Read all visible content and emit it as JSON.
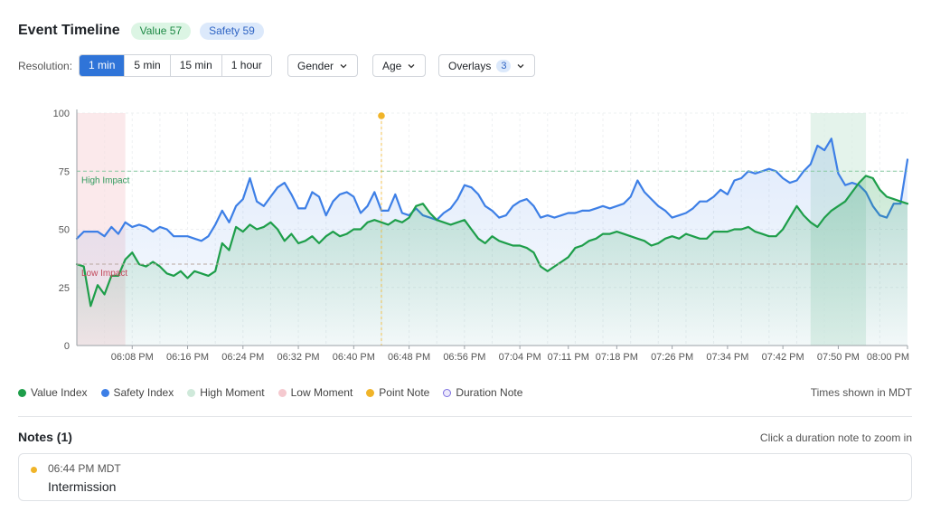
{
  "header": {
    "title": "Event Timeline",
    "value_badge": "Value 57",
    "safety_badge": "Safety 59"
  },
  "controls": {
    "resolution_label": "Resolution:",
    "resolutions": [
      "1 min",
      "5 min",
      "15 min",
      "1 hour"
    ],
    "active_resolution": "1 min",
    "gender_label": "Gender",
    "age_label": "Age",
    "overlays_label": "Overlays",
    "overlays_count": "3"
  },
  "colors": {
    "value": "#1e9e4a",
    "safety": "#3d7fe6",
    "high_moment": "#cfe9da",
    "low_moment": "#f5c9cf",
    "point_note": "#f0b429",
    "duration_note": "#7d6fe0"
  },
  "chart_data": {
    "type": "line",
    "y_range": [
      0,
      100
    ],
    "y_ticks": [
      0,
      25,
      50,
      75,
      100
    ],
    "x_start": "06:00 PM",
    "x_end": "08:00 PM",
    "x_ticks": [
      "06:08 PM",
      "06:16 PM",
      "06:24 PM",
      "06:32 PM",
      "06:40 PM",
      "06:48 PM",
      "06:56 PM",
      "07:04 PM",
      "07:11 PM",
      "07:18 PM",
      "07:26 PM",
      "07:34 PM",
      "07:42 PM",
      "07:50 PM",
      "08:00 PM"
    ],
    "grid": true,
    "reference_lines": [
      {
        "label": "High Impact",
        "value": 75,
        "color": "#86c9a0"
      },
      {
        "label": "Low Impact",
        "value": 35,
        "color": "#b9a89f"
      }
    ],
    "moment_bands": [
      {
        "kind": "low",
        "start": "06:00 PM",
        "end": "06:07 PM"
      },
      {
        "kind": "high",
        "start": "07:46 PM",
        "end": "07:54 PM"
      }
    ],
    "point_notes": [
      {
        "time": "06:44 PM"
      }
    ],
    "series": [
      {
        "name": "Safety Index",
        "x": [
          "06:00 PM",
          "06:01 PM",
          "06:02 PM",
          "06:03 PM",
          "06:04 PM",
          "06:05 PM",
          "06:06 PM",
          "06:07 PM",
          "06:08 PM",
          "06:09 PM",
          "06:10 PM",
          "06:11 PM",
          "06:12 PM",
          "06:13 PM",
          "06:14 PM",
          "06:15 PM",
          "06:16 PM",
          "06:17 PM",
          "06:18 PM",
          "06:19 PM",
          "06:20 PM",
          "06:21 PM",
          "06:22 PM",
          "06:23 PM",
          "06:24 PM",
          "06:25 PM",
          "06:26 PM",
          "06:27 PM",
          "06:28 PM",
          "06:29 PM",
          "06:30 PM",
          "06:31 PM",
          "06:32 PM",
          "06:33 PM",
          "06:34 PM",
          "06:35 PM",
          "06:36 PM",
          "06:37 PM",
          "06:38 PM",
          "06:39 PM",
          "06:40 PM",
          "06:41 PM",
          "06:42 PM",
          "06:43 PM",
          "06:44 PM",
          "06:45 PM",
          "06:46 PM",
          "06:47 PM",
          "06:48 PM",
          "06:49 PM",
          "06:50 PM",
          "06:51 PM",
          "06:52 PM",
          "06:53 PM",
          "06:54 PM",
          "06:55 PM",
          "06:56 PM",
          "06:57 PM",
          "06:58 PM",
          "06:59 PM",
          "07:00 PM",
          "07:01 PM",
          "07:02 PM",
          "07:03 PM",
          "07:04 PM",
          "07:05 PM",
          "07:06 PM",
          "07:07 PM",
          "07:08 PM",
          "07:09 PM",
          "07:10 PM",
          "07:11 PM",
          "07:12 PM",
          "07:13 PM",
          "07:14 PM",
          "07:15 PM",
          "07:16 PM",
          "07:17 PM",
          "07:18 PM",
          "07:19 PM",
          "07:20 PM",
          "07:21 PM",
          "07:22 PM",
          "07:23 PM",
          "07:24 PM",
          "07:25 PM",
          "07:26 PM",
          "07:27 PM",
          "07:28 PM",
          "07:29 PM",
          "07:30 PM",
          "07:31 PM",
          "07:32 PM",
          "07:33 PM",
          "07:34 PM",
          "07:35 PM",
          "07:36 PM",
          "07:37 PM",
          "07:38 PM",
          "07:39 PM",
          "07:40 PM",
          "07:41 PM",
          "07:42 PM",
          "07:43 PM",
          "07:44 PM",
          "07:45 PM",
          "07:46 PM",
          "07:47 PM",
          "07:48 PM",
          "07:49 PM",
          "07:50 PM",
          "07:51 PM",
          "07:52 PM",
          "07:53 PM",
          "07:54 PM",
          "07:55 PM",
          "07:56 PM",
          "07:57 PM",
          "07:58 PM",
          "07:59 PM",
          "08:00 PM"
        ],
        "values": [
          46,
          49,
          49,
          49,
          47,
          51,
          48,
          53,
          51,
          52,
          51,
          49,
          51,
          50,
          47,
          47,
          47,
          46,
          45,
          47,
          52,
          58,
          53,
          60,
          63,
          72,
          62,
          60,
          64,
          68,
          70,
          65,
          59,
          59,
          66,
          64,
          56,
          62,
          65,
          66,
          64,
          57,
          60,
          66,
          58,
          58,
          65,
          57,
          56,
          59,
          56,
          55,
          54,
          57,
          59,
          63,
          69,
          68,
          65,
          60,
          58,
          55,
          56,
          60,
          62,
          63,
          60,
          55,
          56,
          55,
          56,
          57,
          57,
          58,
          58,
          59,
          60,
          59,
          60,
          61,
          64,
          71,
          66,
          63,
          60,
          58,
          55,
          56,
          57,
          59,
          62,
          62,
          64,
          67,
          65,
          71,
          72,
          75,
          74,
          75,
          76,
          75,
          72,
          70,
          71,
          75,
          78,
          86,
          84,
          89,
          74,
          69,
          70,
          69,
          66,
          60,
          56,
          55,
          61,
          61,
          80
        ]
      },
      {
        "name": "Value Index",
        "x": [
          "06:00 PM",
          "06:01 PM",
          "06:02 PM",
          "06:03 PM",
          "06:04 PM",
          "06:05 PM",
          "06:06 PM",
          "06:07 PM",
          "06:08 PM",
          "06:09 PM",
          "06:10 PM",
          "06:11 PM",
          "06:12 PM",
          "06:13 PM",
          "06:14 PM",
          "06:15 PM",
          "06:16 PM",
          "06:17 PM",
          "06:18 PM",
          "06:19 PM",
          "06:20 PM",
          "06:21 PM",
          "06:22 PM",
          "06:23 PM",
          "06:24 PM",
          "06:25 PM",
          "06:26 PM",
          "06:27 PM",
          "06:28 PM",
          "06:29 PM",
          "06:30 PM",
          "06:31 PM",
          "06:32 PM",
          "06:33 PM",
          "06:34 PM",
          "06:35 PM",
          "06:36 PM",
          "06:37 PM",
          "06:38 PM",
          "06:39 PM",
          "06:40 PM",
          "06:41 PM",
          "06:42 PM",
          "06:43 PM",
          "06:44 PM",
          "06:45 PM",
          "06:46 PM",
          "06:47 PM",
          "06:48 PM",
          "06:49 PM",
          "06:50 PM",
          "06:51 PM",
          "06:52 PM",
          "06:53 PM",
          "06:54 PM",
          "06:55 PM",
          "06:56 PM",
          "06:57 PM",
          "06:58 PM",
          "06:59 PM",
          "07:00 PM",
          "07:01 PM",
          "07:02 PM",
          "07:03 PM",
          "07:04 PM",
          "07:05 PM",
          "07:06 PM",
          "07:07 PM",
          "07:08 PM",
          "07:09 PM",
          "07:10 PM",
          "07:11 PM",
          "07:12 PM",
          "07:13 PM",
          "07:14 PM",
          "07:15 PM",
          "07:16 PM",
          "07:17 PM",
          "07:18 PM",
          "07:19 PM",
          "07:20 PM",
          "07:21 PM",
          "07:22 PM",
          "07:23 PM",
          "07:24 PM",
          "07:25 PM",
          "07:26 PM",
          "07:27 PM",
          "07:28 PM",
          "07:29 PM",
          "07:30 PM",
          "07:31 PM",
          "07:32 PM",
          "07:33 PM",
          "07:34 PM",
          "07:35 PM",
          "07:36 PM",
          "07:37 PM",
          "07:38 PM",
          "07:39 PM",
          "07:40 PM",
          "07:41 PM",
          "07:42 PM",
          "07:43 PM",
          "07:44 PM",
          "07:45 PM",
          "07:46 PM",
          "07:47 PM",
          "07:48 PM",
          "07:49 PM",
          "07:50 PM",
          "07:51 PM",
          "07:52 PM",
          "07:53 PM",
          "07:54 PM",
          "07:55 PM",
          "07:56 PM",
          "07:57 PM",
          "07:58 PM",
          "07:59 PM",
          "08:00 PM"
        ],
        "values": [
          35,
          34,
          17,
          26,
          22,
          30,
          30,
          37,
          40,
          35,
          34,
          36,
          34,
          31,
          30,
          32,
          29,
          32,
          31,
          30,
          32,
          44,
          41,
          51,
          49,
          52,
          50,
          51,
          53,
          50,
          45,
          48,
          44,
          45,
          47,
          44,
          47,
          49,
          47,
          48,
          50,
          50,
          53,
          54,
          53,
          52,
          54,
          53,
          55,
          60,
          61,
          57,
          54,
          53,
          52,
          53,
          54,
          50,
          46,
          44,
          47,
          45,
          44,
          43,
          43,
          42,
          40,
          34,
          32,
          34,
          36,
          38,
          42,
          43,
          45,
          46,
          48,
          48,
          49,
          48,
          47,
          46,
          45,
          43,
          44,
          46,
          47,
          46,
          48,
          47,
          46,
          46,
          49,
          49,
          49,
          50,
          50,
          51,
          49,
          48,
          47,
          47,
          50,
          55,
          60,
          56,
          53,
          51,
          55,
          58,
          60,
          62,
          66,
          70,
          73,
          72,
          67,
          64,
          63,
          62,
          61
        ]
      }
    ]
  },
  "legend": {
    "value_index": "Value Index",
    "safety_index": "Safety Index",
    "high_moment": "High Moment",
    "low_moment": "Low Moment",
    "point_note": "Point Note",
    "duration_note": "Duration Note",
    "timezone_note": "Times shown in MDT"
  },
  "notes": {
    "title": "Notes (1)",
    "hint": "Click a duration note to zoom in",
    "items": [
      {
        "time": "06:44 PM MDT",
        "text": "Intermission"
      }
    ]
  }
}
